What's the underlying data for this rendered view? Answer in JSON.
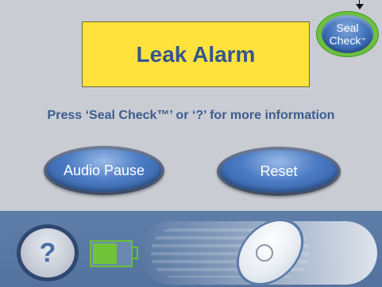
{
  "alarm": {
    "text": "Leak Alarm"
  },
  "seal_check": {
    "line1": "Seal",
    "line2": "Check",
    "tm": "™"
  },
  "instruction": "Press ‘Seal Check™’ or  ‘?’ for more information",
  "buttons": {
    "audio_pause": "Audio Pause",
    "reset": "Reset"
  },
  "help": {
    "label": "?"
  },
  "battery": {
    "level_fraction": 0.65,
    "color": "#72c23a"
  },
  "icons": [
    "help-icon",
    "battery-icon",
    "slider-lock-icon",
    "arrow-icon"
  ]
}
